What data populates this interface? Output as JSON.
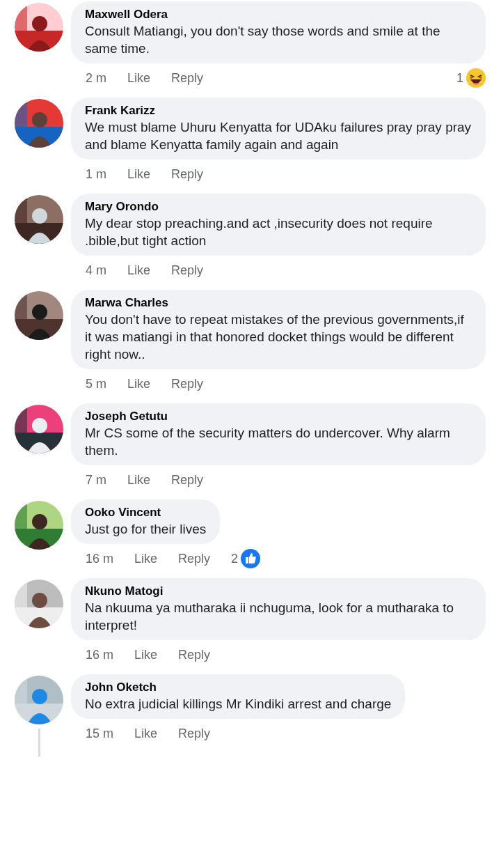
{
  "comments": [
    {
      "author": "Maxwell Odera",
      "text": "Consult Matiangi, you don't say those words and smile at the same time.",
      "time": "2 m",
      "like": "Like",
      "reply": "Reply",
      "reaction": {
        "kind": "haha",
        "count": "1"
      }
    },
    {
      "author": "Frank Karizz",
      "text": "We must blame Uhuru Kenyatta for UDAku failures pray pray pray and blame Kenyatta family again and again",
      "time": "1 m",
      "like": "Like",
      "reply": "Reply"
    },
    {
      "author": "Mary Orondo",
      "text": "My dear stop preaching.and act ,insecurity does not require .bible,but tight action",
      "time": "4 m",
      "like": "Like",
      "reply": "Reply"
    },
    {
      "author": "Marwa Charles",
      "text": "You don't have to repeat mistakes of the previous governments,if it was matiangi in that honored docket things would be different right now..",
      "time": "5 m",
      "like": "Like",
      "reply": "Reply"
    },
    {
      "author": "Joseph Getutu",
      "text": "Mr CS some of the security matters do undercover. Why alarm them.",
      "time": "7 m",
      "like": "Like",
      "reply": "Reply"
    },
    {
      "author": "Ooko Vincent",
      "text": "Just go for their lives",
      "time": "16 m",
      "like": "Like",
      "reply": "Reply",
      "reaction": {
        "kind": "like",
        "count": "2"
      }
    },
    {
      "author": "Nkuno Matogi",
      "text": "Na nkuuma ya mutharaka ii nchuguma, look for a mutharaka to interpret!",
      "time": "16 m",
      "like": "Like",
      "reply": "Reply"
    },
    {
      "author": "John Oketch",
      "text": "No extra judicial killings Mr Kindiki arrest and charge",
      "time": "15 m",
      "like": "Like",
      "reply": "Reply",
      "has_replies": true
    }
  ]
}
